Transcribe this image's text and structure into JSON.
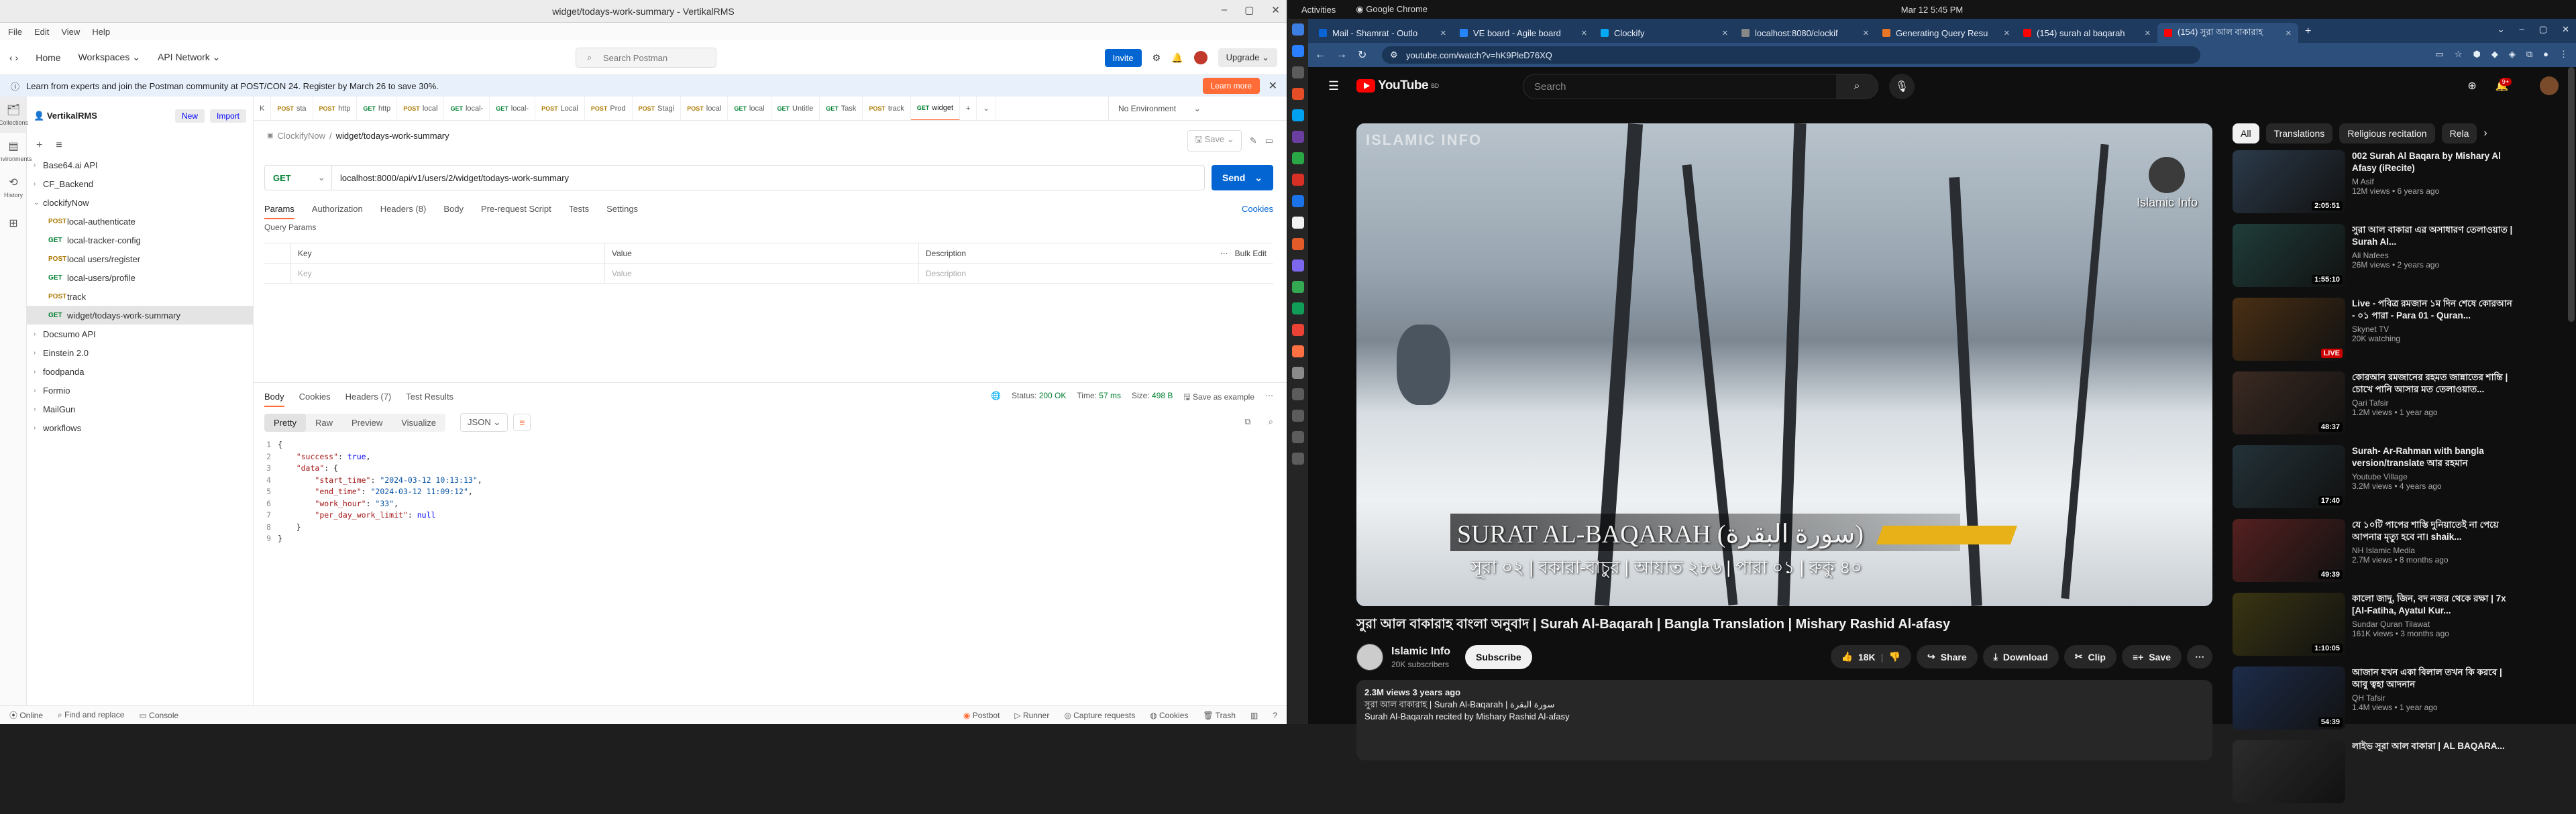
{
  "postman": {
    "window_title": "widget/todays-work-summary - VertikalRMS",
    "menu": [
      "File",
      "Edit",
      "View",
      "Help"
    ],
    "nav": {
      "home": "Home",
      "workspaces": "Workspaces",
      "api_network": "API Network"
    },
    "search_placeholder": "Search Postman",
    "invite": "Invite",
    "upgrade": "Upgrade",
    "banner_text": "Learn from experts and join the Postman community at POST/CON 24. Register by March 26 to save 30%.",
    "banner_button": "Learn more",
    "rail": [
      "Collections",
      "Environments",
      "History"
    ],
    "workspace_name": "VertikalRMS",
    "new_button": "New",
    "import_button": "Import",
    "tree": [
      {
        "type": "folder",
        "label": "Base64.ai API",
        "depth": 0,
        "open": false
      },
      {
        "type": "folder",
        "label": "CF_Backend",
        "depth": 0,
        "open": false
      },
      {
        "type": "folder",
        "label": "clockifyNow",
        "depth": 0,
        "open": true
      },
      {
        "type": "req",
        "method": "POST",
        "label": "local-authenticate",
        "depth": 1
      },
      {
        "type": "req",
        "method": "GET",
        "label": "local-tracker-config",
        "depth": 1
      },
      {
        "type": "req",
        "method": "POST",
        "label": "local users/register",
        "depth": 1
      },
      {
        "type": "req",
        "method": "GET",
        "label": "local-users/profile",
        "depth": 1
      },
      {
        "type": "req",
        "method": "POST",
        "label": "track",
        "depth": 1
      },
      {
        "type": "req",
        "method": "GET",
        "label": "widget/todays-work-summary",
        "depth": 1,
        "selected": true
      },
      {
        "type": "folder",
        "label": "Docsumo API",
        "depth": 0,
        "open": false
      },
      {
        "type": "folder",
        "label": "Einstein 2.0",
        "depth": 0,
        "open": false
      },
      {
        "type": "folder",
        "label": "foodpanda",
        "depth": 0,
        "open": false
      },
      {
        "type": "folder",
        "label": "Formio",
        "depth": 0,
        "open": false
      },
      {
        "type": "folder",
        "label": "MailGun",
        "depth": 0,
        "open": false
      },
      {
        "type": "folder",
        "label": "workflows",
        "depth": 0,
        "open": false
      }
    ],
    "req_tabs": [
      {
        "method": "",
        "label": "K"
      },
      {
        "method": "POST",
        "label": "sta"
      },
      {
        "method": "POST",
        "label": "http"
      },
      {
        "method": "GET",
        "label": "http"
      },
      {
        "method": "POST",
        "label": "local"
      },
      {
        "method": "GET",
        "label": "local-"
      },
      {
        "method": "GET",
        "label": "local-"
      },
      {
        "method": "POST",
        "label": "Local"
      },
      {
        "method": "POST",
        "label": "Prod"
      },
      {
        "method": "POST",
        "label": "Stagi"
      },
      {
        "method": "POST",
        "label": "local"
      },
      {
        "method": "GET",
        "label": "local"
      },
      {
        "method": "GET",
        "label": "Untitle"
      },
      {
        "method": "GET",
        "label": "Task"
      },
      {
        "method": "POST",
        "label": "track"
      },
      {
        "method": "GET",
        "label": "widget",
        "active": true
      }
    ],
    "environment": "No Environment",
    "breadcrumb": {
      "parent": "ClockifyNow",
      "sep": "/",
      "current": "widget/todays-work-summary"
    },
    "save": "Save",
    "method": "GET",
    "url": "localhost:8000/api/v1/users/2/widget/todays-work-summary",
    "send": "Send",
    "request_tabs": [
      "Params",
      "Authorization",
      "Headers (8)",
      "Body",
      "Pre-request Script",
      "Tests",
      "Settings"
    ],
    "cookies": "Cookies",
    "query_params_label": "Query Params",
    "param_cols": [
      "Key",
      "Value",
      "Description"
    ],
    "bulk_edit": "Bulk Edit",
    "param_placeholders": [
      "Key",
      "Value",
      "Description"
    ],
    "response_tabs": [
      "Body",
      "Cookies",
      "Headers (7)",
      "Test Results"
    ],
    "status": {
      "label": "Status:",
      "code": "200 OK",
      "time_label": "Time:",
      "time": "57 ms",
      "size_label": "Size:",
      "size": "498 B"
    },
    "save_example": "Save as example",
    "view_modes": [
      "Pretty",
      "Raw",
      "Preview",
      "Visualize"
    ],
    "format": "JSON",
    "code_lines": [
      "{",
      "    \"success\": true,",
      "    \"data\": {",
      "        \"start_time\": \"2024-03-12 10:13:13\",",
      "        \"end_time\": \"2024-03-12 11:09:12\",",
      "        \"work_hour\": \"33\",",
      "        \"per_day_work_limit\": null",
      "    }",
      "}"
    ],
    "statusbar_left": [
      "Online",
      "Find and replace",
      "Console"
    ],
    "statusbar_right": [
      "Postbot",
      "Runner",
      "Capture requests",
      "Cookies",
      "Trash"
    ]
  },
  "ubuntu": {
    "activities": "Activities",
    "app": "Google Chrome",
    "clock": "Mar 12  5:45 PM"
  },
  "chrome": {
    "tabs": [
      {
        "label": "Mail - Shamrat - Outlo",
        "color": "#0a64d6"
      },
      {
        "label": "VE board - Agile board",
        "color": "#2684ff"
      },
      {
        "label": "Clockify",
        "color": "#03a9f4"
      },
      {
        "label": "localhost:8080/clockif",
        "color": "#888888"
      },
      {
        "label": "Generating Query Resu",
        "color": "#e97627"
      },
      {
        "label": "(154) surah al baqarah",
        "color": "#ff0000"
      },
      {
        "label": "(154) সুরা আল বাকারাহ",
        "color": "#ff0000",
        "active": true
      }
    ],
    "url": "youtube.com/watch?v=hK9PleD76XQ"
  },
  "youtube": {
    "search_placeholder": "Search",
    "notifications": "9+",
    "logo_sup": "BD",
    "player": {
      "watermark_tl": "ISLAMIC INFO",
      "watermark_tr": "Islamic Info",
      "caption_title": "SURAT AL-BAQARAH (سورة البقرة)",
      "caption_sub": "সূরা ০২ | বকারা-বাচুর | আয়াত ২৮৬ | পারা ০১ | রুকু ৪০"
    },
    "video_title": "সুরা আল বাকারাহ বাংলা অনুবাদ | Surah Al-Baqarah | Bangla Translation | Mishary Rashid Al-afasy",
    "channel": {
      "name": "Islamic Info",
      "subs": "20K subscribers",
      "subscribe": "Subscribe"
    },
    "actions": {
      "likes": "18K",
      "share": "Share",
      "download": "Download",
      "clip": "Clip",
      "save": "Save"
    },
    "description": {
      "meta": "2.3M views  3 years ago",
      "line1": "সুরা আল বাকারাহ | Surah Al-Baqarah | سورة البقرة",
      "line2": "Surah Al-Baqarah recited by Mishary Rashid Al-afasy"
    },
    "chips": [
      "All",
      "Translations",
      "Religious recitation",
      "Rela"
    ],
    "related": [
      {
        "title": "002 Surah Al Baqara by Mishary Al Afasy (iRecite)",
        "channel": "M Asif",
        "views": "12M views • 6 years ago",
        "duration": "2:05:51",
        "thumb": "#2b3a4a"
      },
      {
        "title": "সুরা আল বাকারা এর অসাধারণ তেলাওয়াত | Surah Al...",
        "channel": "Ali Nafees",
        "views": "26M views • 2 years ago",
        "duration": "1:55:10",
        "thumb": "#1f3d3a"
      },
      {
        "title": "Live - পবিত্র রমজান ১ম দিন শেষে কোরআন - ০১ পারা - Para 01 - Quran...",
        "channel": "Skynet TV",
        "views": "20K watching",
        "live": "LIVE",
        "thumb": "#4a2f14"
      },
      {
        "title": "কোরআন রমজানের রহমত জান্নাতের শান্তি | চোখে পানি আসার মত তেলাওয়াত...",
        "channel": "Qari Tafsir",
        "views": "1.2M views • 1 year ago",
        "duration": "48:37",
        "thumb": "#3b2a22"
      },
      {
        "title": "Surah- Ar-Rahman with bangla version/translate আর রহমান",
        "channel": "Youtube Village",
        "views": "3.2M views • 4 years ago",
        "duration": "17:40",
        "thumb": "#233238"
      },
      {
        "title": "যে ১০টি পাপের শাস্তি দুনিয়াতেই না পেয়ে আপনার মৃত্যু হবে না। shaik...",
        "channel": "NH Islamic Media",
        "views": "2.7M views • 8 months ago",
        "duration": "49:39",
        "thumb": "#552020"
      },
      {
        "title": "কালো জাদু, জিন, বদ নজর থেকে রক্ষা | 7x [Al-Fatiha, Ayatul Kur...",
        "channel": "Sundar Quran Tilawat",
        "views": "161K views • 3 months ago",
        "duration": "1:10:05",
        "thumb": "#3a3512"
      },
      {
        "title": "আজান যখন একা বিলাল তখন কি করবে | আবু ত্বহা আদনান",
        "channel": "QH Tafsir",
        "views": "1.4M views • 1 year ago",
        "duration": "54:39",
        "thumb": "#1d2c4a"
      },
      {
        "title": "লাইভ সূরা আল বাকারা | AL BAQARA...",
        "channel": "",
        "views": "",
        "duration": "",
        "thumb": "#2c2c2c"
      }
    ]
  },
  "dock_colors": [
    "#3b7de0",
    "#2a7fff",
    "#5c5c5c",
    "#e44d26",
    "#00a1f1",
    "#6b3fa0",
    "#2aa845",
    "#d93025",
    "#1a73e8",
    "#f2f2f2",
    "#e45b2a",
    "#7b68ee",
    "#34a853",
    "#0f9d58",
    "#ea4335",
    "#ff7043",
    "#8a8a8a",
    "#5c5c5c",
    "#5c5c5c",
    "#5c5c5c",
    "#5c5c5c"
  ]
}
